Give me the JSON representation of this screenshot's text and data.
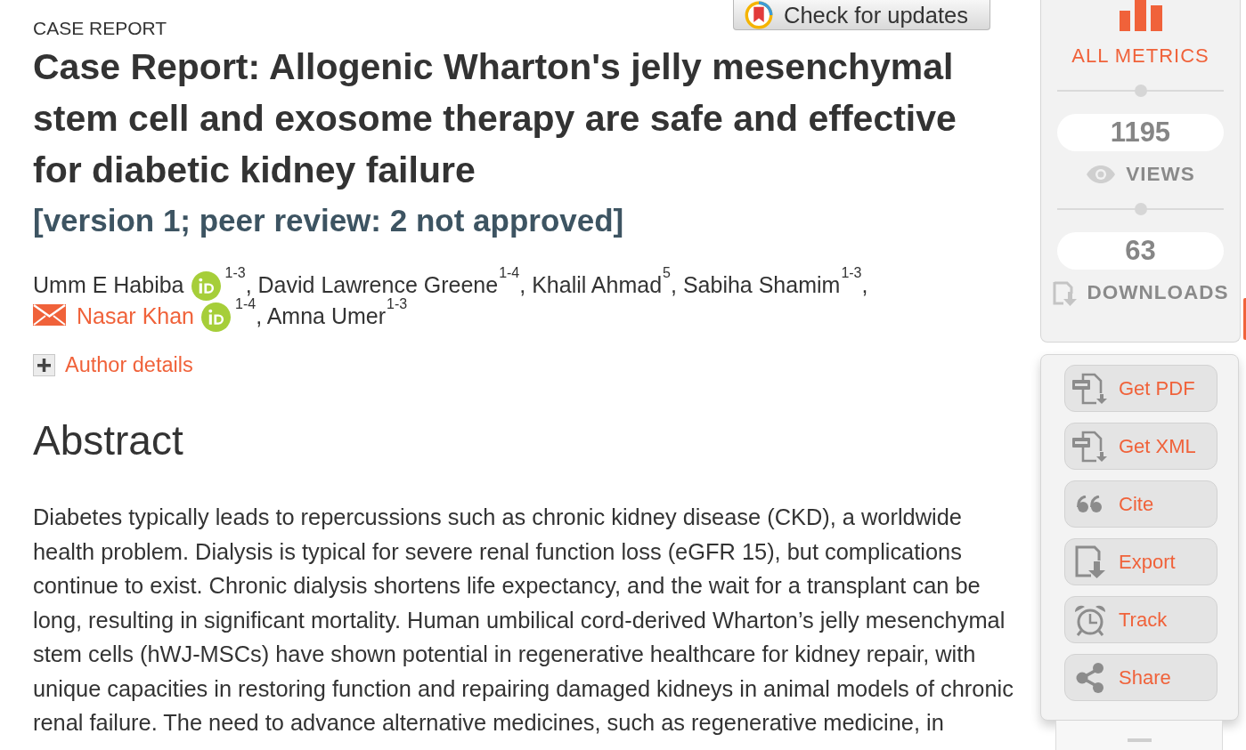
{
  "header": {
    "update_button": "Check for updates"
  },
  "article": {
    "type_label": "CASE REPORT",
    "title": "Case Report: Allogenic Wharton's jelly mesenchymal stem cell and exosome therapy are safe and effective for diabetic kidney failure",
    "version_note": "[version 1; peer review: 2 not approved]",
    "authors": [
      {
        "name": "Umm E Habiba",
        "orcid": true,
        "corresponding": false,
        "affiliation": "$^{1-3}$,"
      },
      {
        "name": "David Lawrence Greene",
        "orcid": false,
        "corresponding": false,
        "affiliation": "$^{1-4}$,"
      },
      {
        "name": "Khalil Ahmad",
        "orcid": false,
        "corresponding": false,
        "affiliation": "$^{5}$,"
      },
      {
        "name": "Sabiha Shamim",
        "orcid": false,
        "corresponding": false,
        "affiliation": "$^{1-3}$,"
      },
      {
        "name": "Nasar Khan",
        "orcid": true,
        "corresponding": true,
        "affiliation": "$^{1-4}$,"
      },
      {
        "name": "Amna Umer",
        "orcid": false,
        "corresponding": false,
        "affiliation": "$^{1-3}$"
      }
    ],
    "author_details": {
      "label": "Author details",
      "expanded": false
    },
    "abstract": {
      "heading": "Abstract",
      "text": "Diabetes typically leads to repercussions such as chronic kidney disease (CKD), a worldwide health problem. Dialysis is typical for severe renal function loss (eGFR 15), but complications continue to exist. Chronic dialysis shortens life expectancy, and the wait for a transplant can be long, resulting in significant mortality. Human umbilical cord-derived Wharton’s jelly mesenchymal stem cells (hWJ-MSCs) have shown potential in regenerative healthcare for kidney repair, with unique capacities in restoring function and repairing damaged kidneys in animal models of chronic renal failure. The need to advance alternative medicines, such as regenerative medicine, in"
    }
  },
  "metrics": {
    "label": "ALL METRICS",
    "stats": [
      {
        "kind": "views",
        "value": "1195",
        "label": "VIEWS"
      },
      {
        "kind": "downloads",
        "value": "63",
        "label": "DOWNLOADS"
      }
    ]
  },
  "actions": [
    {
      "kind": "pdf",
      "label": "Get PDF"
    },
    {
      "kind": "xml",
      "label": "Get XML"
    },
    {
      "kind": "cite",
      "label": "Cite"
    },
    {
      "kind": "export",
      "label": "Export"
    },
    {
      "kind": "track",
      "label": "Track"
    },
    {
      "kind": "share",
      "label": "Share"
    }
  ]
}
